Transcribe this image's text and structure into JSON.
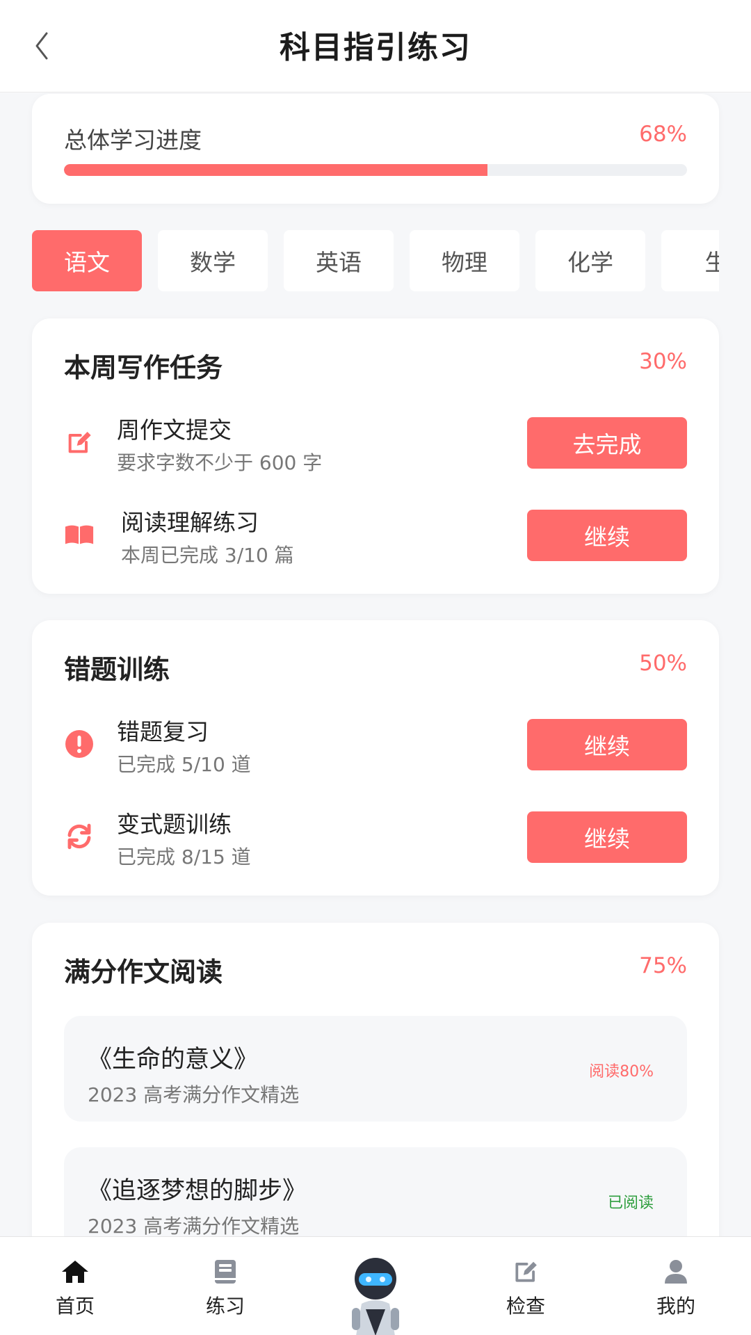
{
  "header": {
    "title": "科目指引练习",
    "back_icon": "chevron-left-icon"
  },
  "overall_progress": {
    "label": "总体学习进度",
    "percent_text": "68%",
    "value": 0.68
  },
  "tabs": [
    {
      "label": "语文",
      "active": true
    },
    {
      "label": "数学",
      "active": false
    },
    {
      "label": "英语",
      "active": false
    },
    {
      "label": "物理",
      "active": false
    },
    {
      "label": "化学",
      "active": false
    },
    {
      "label": "生",
      "active": false
    }
  ],
  "writing": {
    "title": "本周写作任务",
    "percent": "30%",
    "items": [
      {
        "icon": "edit-icon",
        "title": "周作文提交",
        "subtitle": "要求字数不少于 600 字",
        "button": "去完成"
      },
      {
        "icon": "book-open-icon",
        "title": "阅读理解练习",
        "subtitle": "本周已完成 3/10 篇",
        "button": "继续"
      }
    ]
  },
  "mistakes": {
    "title": "错题训练",
    "percent": "50%",
    "items": [
      {
        "icon": "alert-circle-icon",
        "title": "错题复习",
        "subtitle": "已完成 5/10 道",
        "button": "继续"
      },
      {
        "icon": "refresh-icon",
        "title": "变式题训练",
        "subtitle": "已完成 8/15 道",
        "button": "继续"
      }
    ]
  },
  "essays": {
    "title": "满分作文阅读",
    "percent": "75%",
    "items": [
      {
        "title": "《生命的意义》",
        "source": "2023 高考满分作文精选",
        "status": "阅读80%",
        "status_color": "#ff6b6b"
      },
      {
        "title": "《追逐梦想的脚步》",
        "source": "2023 高考满分作文精选",
        "status": "已阅读",
        "status_color": "#2e9e3e"
      }
    ]
  },
  "bottom_nav": [
    {
      "label": "首页",
      "icon": "home-icon"
    },
    {
      "label": "练习",
      "icon": "book-icon"
    },
    {
      "label": "",
      "icon": "robot-avatar-icon"
    },
    {
      "label": "检查",
      "icon": "edit-icon"
    },
    {
      "label": "我的",
      "icon": "user-icon"
    }
  ],
  "colors": {
    "accent": "#ff6b6b",
    "success": "#2e9e3e",
    "background": "#f6f7f9"
  }
}
